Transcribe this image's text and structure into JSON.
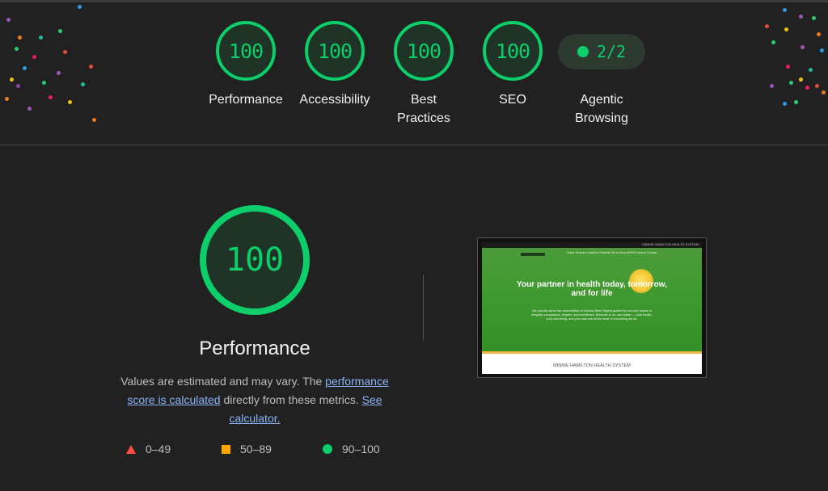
{
  "colors": {
    "pass": "#0cce6b",
    "average": "#ffa400",
    "fail": "#ff4e42",
    "background": "#212121",
    "link": "#8ab4f8"
  },
  "summary": {
    "categories": [
      {
        "score": "100",
        "label": "Performance"
      },
      {
        "score": "100",
        "label": "Accessibility"
      },
      {
        "score": "100",
        "label": "Best Practices"
      },
      {
        "score": "100",
        "label": "SEO"
      }
    ],
    "agentic": {
      "score": "2/2",
      "label": "Agentic Browsing"
    }
  },
  "performance": {
    "score": "100",
    "title": "Performance",
    "description_prefix": "Values are estimated and may vary. The ",
    "score_link": "performance score is calculated",
    "description_middle": " directly from these metrics. ",
    "calculator_link": "See calculator."
  },
  "legend": [
    {
      "icon": "red-triangle-icon",
      "range": "0–49"
    },
    {
      "icon": "orange-square-icon",
      "range": "50–89"
    },
    {
      "icon": "green-circle-icon",
      "range": "90–100"
    }
  ],
  "screenshot": {
    "topbar": "MINNIE HAMILTON HEALTH SYSTEM",
    "nav": "Home   Services   Locations   Patients   Get to Know MHHS   Careers   Contact",
    "headline": "Your partner in health today, tomorrow, and for life",
    "body": "We proudly serve the communities of Central West Virginia guided by our core values of integrity, compassion, respect, and excellence. Because to us, you matter — your health, your well-being, and your care are at the heart of everything we do.",
    "footer": "MINNIE HAMILTON HEALTH SYSTEM"
  }
}
